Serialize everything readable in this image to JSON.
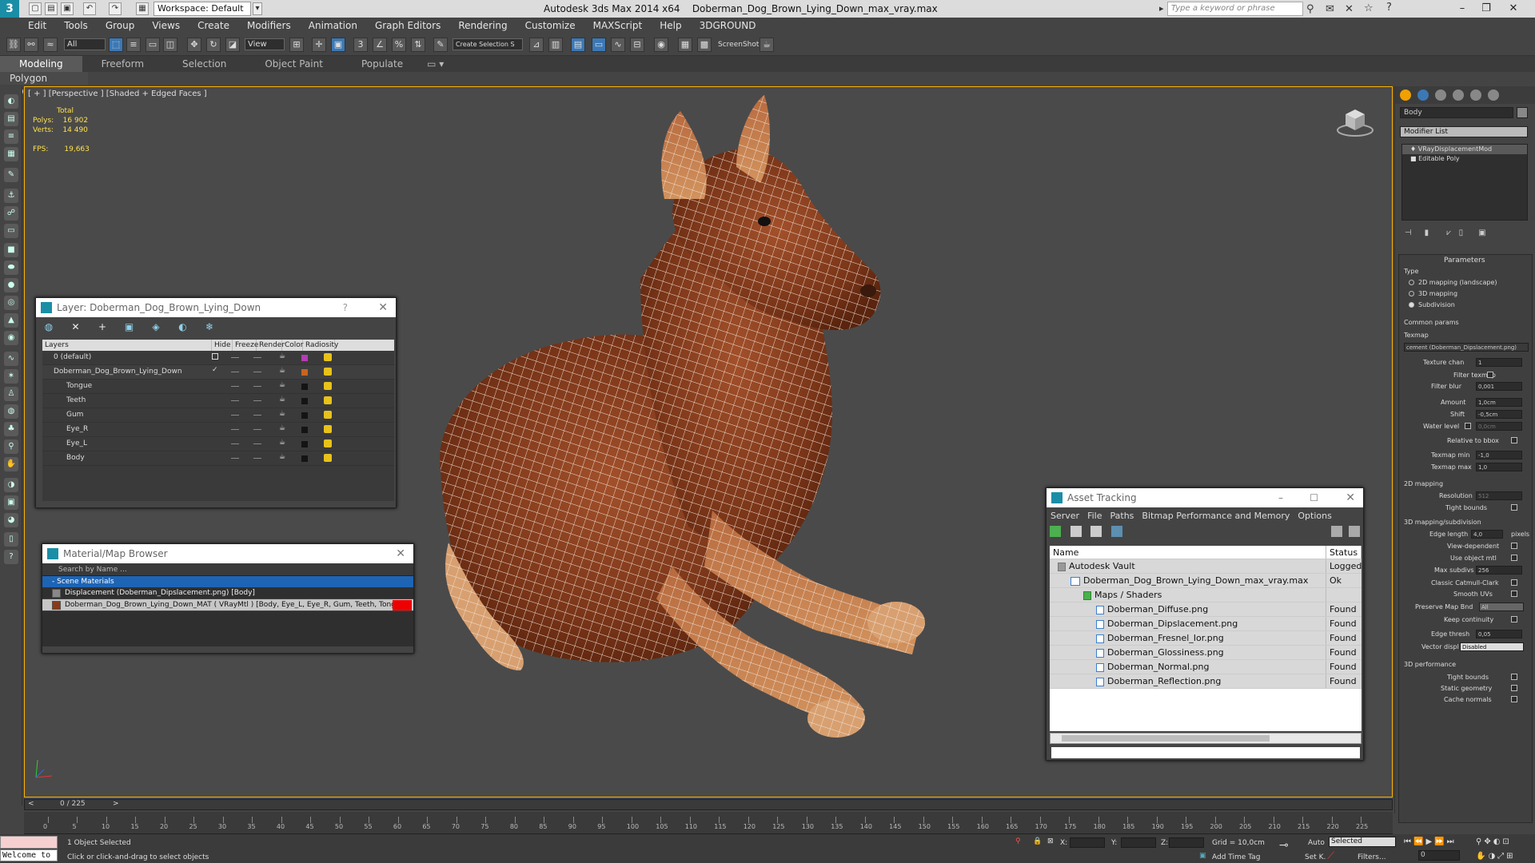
{
  "titlebar": {
    "workspace": "Workspace: Default",
    "app_title": "Autodesk 3ds Max  2014 x64",
    "file_name": "Doberman_Dog_Brown_Lying_Down_max_vray.max",
    "search_placeholder": "Type a keyword or phrase"
  },
  "menu": [
    "Edit",
    "Tools",
    "Group",
    "Views",
    "Create",
    "Modifiers",
    "Animation",
    "Graph Editors",
    "Rendering",
    "Customize",
    "MAXScript",
    "Help",
    "3DGROUND"
  ],
  "toolbar": {
    "selection_filter": "All",
    "ref_coord": "View",
    "named_sel": "Create Selection S",
    "screenshot": "ScreenShot"
  },
  "ribbon": {
    "tabs": [
      "Modeling",
      "Freeform",
      "Selection",
      "Object Paint",
      "Populate"
    ],
    "active": "Modeling",
    "sub": "Polygon Modeling"
  },
  "viewport": {
    "label": "[ + ] [Perspective ] [Shaded + Edged Faces ]",
    "stats_total": "Total",
    "polys_label": "Polys:",
    "polys": "16 902",
    "verts_label": "Verts:",
    "verts": "14 490",
    "fps_label": "FPS:",
    "fps": "19,663"
  },
  "layer_panel": {
    "title": "Layer: Doberman_Dog_Brown_Lying_Down",
    "help": "?",
    "columns": [
      "Layers",
      "Hide",
      "Freeze",
      "Render",
      "Color",
      "Radiosity"
    ],
    "rows": [
      {
        "name": "0 (default)",
        "color": "#b43cb4"
      },
      {
        "name": "Doberman_Dog_Brown_Lying_Down",
        "color": "#c8641e"
      },
      {
        "name": "Tongue",
        "color": "#141414"
      },
      {
        "name": "Teeth",
        "color": "#141414"
      },
      {
        "name": "Gum",
        "color": "#141414"
      },
      {
        "name": "Eye_R",
        "color": "#141414"
      },
      {
        "name": "Eye_L",
        "color": "#141414"
      },
      {
        "name": "Body",
        "color": "#141414"
      }
    ]
  },
  "material_browser": {
    "title": "Material/Map Browser",
    "search": "Search by Name ...",
    "group": "- Scene Materials",
    "items": [
      "Displacement (Doberman_Dipslacement.png) [Body]",
      "Doberman_Dog_Brown_Lying_Down_MAT  ( VRayMtl ) [Body, Eye_L, Eye_R, Gum, Teeth, Tongue]"
    ]
  },
  "asset_tracking": {
    "title": "Asset Tracking",
    "menu": [
      "Server",
      "File",
      "Paths",
      "Bitmap Performance and Memory",
      "Options"
    ],
    "columns": [
      "Name",
      "Status"
    ],
    "rows": [
      {
        "name": "Autodesk Vault",
        "status": "Logged O"
      },
      {
        "name": "Doberman_Dog_Brown_Lying_Down_max_vray.max",
        "status": "Ok"
      },
      {
        "name": "Maps / Shaders",
        "status": ""
      },
      {
        "name": "Doberman_Diffuse.png",
        "status": "Found"
      },
      {
        "name": "Doberman_Dipslacement.png",
        "status": "Found"
      },
      {
        "name": "Doberman_Fresnel_Ior.png",
        "status": "Found"
      },
      {
        "name": "Doberman_Glossiness.png",
        "status": "Found"
      },
      {
        "name": "Doberman_Normal.png",
        "status": "Found"
      },
      {
        "name": "Doberman_Reflection.png",
        "status": "Found"
      }
    ]
  },
  "command_panel": {
    "object_name": "Body",
    "modifier_list": "Modifier List",
    "stack": [
      "VRayDisplacementMod",
      "Editable Poly"
    ],
    "parameters": "Parameters",
    "type": "Type",
    "type_options": [
      "2D mapping (landscape)",
      "3D mapping",
      "Subdivision"
    ],
    "common_params": "Common params",
    "texmap": "Texmap",
    "texmap_value": "cement (Doberman_Dipslacement.png)",
    "texture_chan": "Texture chan",
    "texture_chan_v": "1",
    "filter_texmap": "Filter texmap",
    "filter_blur": "Filter blur",
    "filter_blur_v": "0,001",
    "amount": "Amount",
    "amount_v": "1,0cm",
    "shift": "Shift",
    "shift_v": "-0,5cm",
    "water_level": "Water level",
    "water_level_v": "0,0cm",
    "relative_bbox": "Relative to bbox",
    "texmap_min": "Texmap min",
    "texmap_min_v": "-1,0",
    "texmap_max": "Texmap max",
    "texmap_max_v": "1,0",
    "mapping2d": "2D mapping",
    "resolution": "Resolution",
    "resolution_v": "512",
    "tight_bounds": "Tight bounds",
    "mapping3d": "3D mapping/subdivision",
    "edge_length": "Edge length",
    "edge_length_v": "4,0",
    "pixels": "pixels",
    "view_dependent": "View-dependent",
    "use_object_mtl": "Use object mtl",
    "max_subdivs": "Max subdivs",
    "max_subdivs_v": "256",
    "classic_cc": "Classic Catmull-Clark",
    "smooth_uvs": "Smooth UVs",
    "preserve_map": "Preserve Map Bnd",
    "preserve_map_v": "All",
    "keep_continuity": "Keep continuity",
    "edge_thresh": "Edge thresh",
    "edge_thresh_v": "0,05",
    "vector_displ": "Vector displ",
    "vector_displ_v": "Disabled",
    "perf": "3D performance",
    "tight_bounds2": "Tight bounds",
    "static_geometry": "Static geometry",
    "cache_normals": "Cache normals"
  },
  "timeline": {
    "frame": "0 / 225",
    "ticks": [
      "0",
      "5",
      "10",
      "15",
      "20",
      "25",
      "30",
      "35",
      "40",
      "45",
      "50",
      "55",
      "60",
      "65",
      "70",
      "75",
      "80",
      "85",
      "90",
      "95",
      "100",
      "105",
      "110",
      "115",
      "120",
      "125",
      "130",
      "135",
      "140",
      "145",
      "150",
      "155",
      "160",
      "165",
      "170",
      "175",
      "180",
      "185",
      "190",
      "195",
      "200",
      "205",
      "210",
      "215",
      "220",
      "225"
    ]
  },
  "status": {
    "maxscript": "Welcome to",
    "selected": "1 Object Selected",
    "prompt": "Click or click-and-drag to select objects",
    "x": "X:",
    "y": "Y:",
    "z": "Z:",
    "grid": "Grid = 10,0cm",
    "add_time_tag": "Add Time Tag",
    "auto": "Auto",
    "setk": "Set K.",
    "key_mode": "Selected",
    "filters": "Filters...",
    "frame": "0"
  }
}
